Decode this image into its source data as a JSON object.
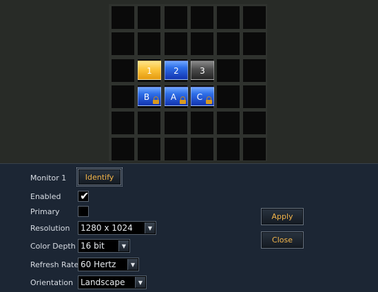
{
  "monitors": {
    "primary_tiles": [
      {
        "label": "1",
        "style": "gold",
        "locked": false
      },
      {
        "label": "2",
        "style": "blue",
        "locked": false
      },
      {
        "label": "3",
        "style": "gray",
        "locked": false
      }
    ],
    "secondary_tiles": [
      {
        "label": "B",
        "style": "blue",
        "locked": true
      },
      {
        "label": "A",
        "style": "blue",
        "locked": true
      },
      {
        "label": "C",
        "style": "blue",
        "locked": true
      }
    ]
  },
  "settings": {
    "monitor_label": "Monitor 1",
    "identify_label": "Identify",
    "enabled_label": "Enabled",
    "enabled_checked": true,
    "primary_label": "Primary",
    "primary_checked": false,
    "resolution_label": "Resolution",
    "resolution_value": "1280 x 1024",
    "color_depth_label": "Color Depth",
    "color_depth_value": "16 bit",
    "refresh_rate_label": "Refresh Rate",
    "refresh_rate_value": "60 Hertz",
    "orientation_label": "Orientation",
    "orientation_value": "Landscape"
  },
  "actions": {
    "apply_label": "Apply",
    "close_label": "Close"
  },
  "colors": {
    "accent_text": "#f3b54a",
    "selected_tile": "#fcc43a",
    "tile_blue": "#2f6fe8",
    "panel_bg": "#1c2634"
  },
  "icons": {
    "checkmark": "check-icon",
    "lock": "lock-icon",
    "dropdown": "chevron-down-icon"
  }
}
